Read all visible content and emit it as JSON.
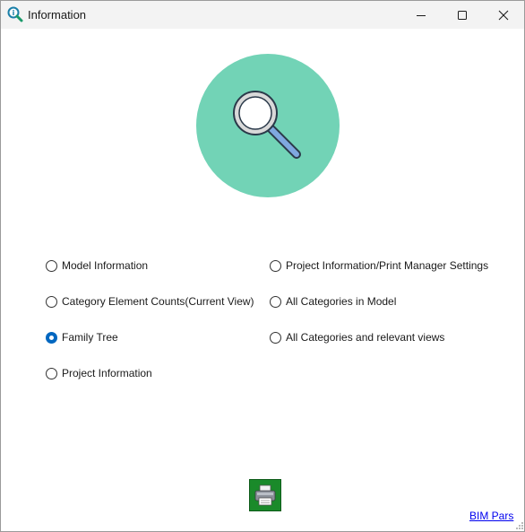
{
  "window": {
    "title": "Information",
    "app_icon": "magnifier-info-icon"
  },
  "titlebar_controls": [
    "minimize-icon",
    "maximize-icon",
    "close-icon"
  ],
  "hero": {
    "icon": "magnifier-icon",
    "background": "#72d3b6"
  },
  "options": {
    "model_information": {
      "label": "Model Information",
      "checked": false
    },
    "category_element_counts": {
      "label": "Category Element Counts(Current View)",
      "checked": false
    },
    "family_tree": {
      "label": "Family Tree",
      "checked": true
    },
    "project_information": {
      "label": "Project Information",
      "checked": false
    },
    "project_info_print_settings": {
      "label": "Project Information/Print Manager Settings",
      "checked": false
    },
    "all_categories_in_model": {
      "label": "All Categories in Model",
      "checked": false
    },
    "all_categories_relevant_views": {
      "label": "All Categories and relevant views",
      "checked": false
    }
  },
  "print_button": {
    "icon": "printer-icon",
    "background": "#1a8a2a"
  },
  "footer": {
    "link_text": "BIM Pars",
    "link_color": "#0000ee"
  },
  "accent_color": "#0067c0"
}
